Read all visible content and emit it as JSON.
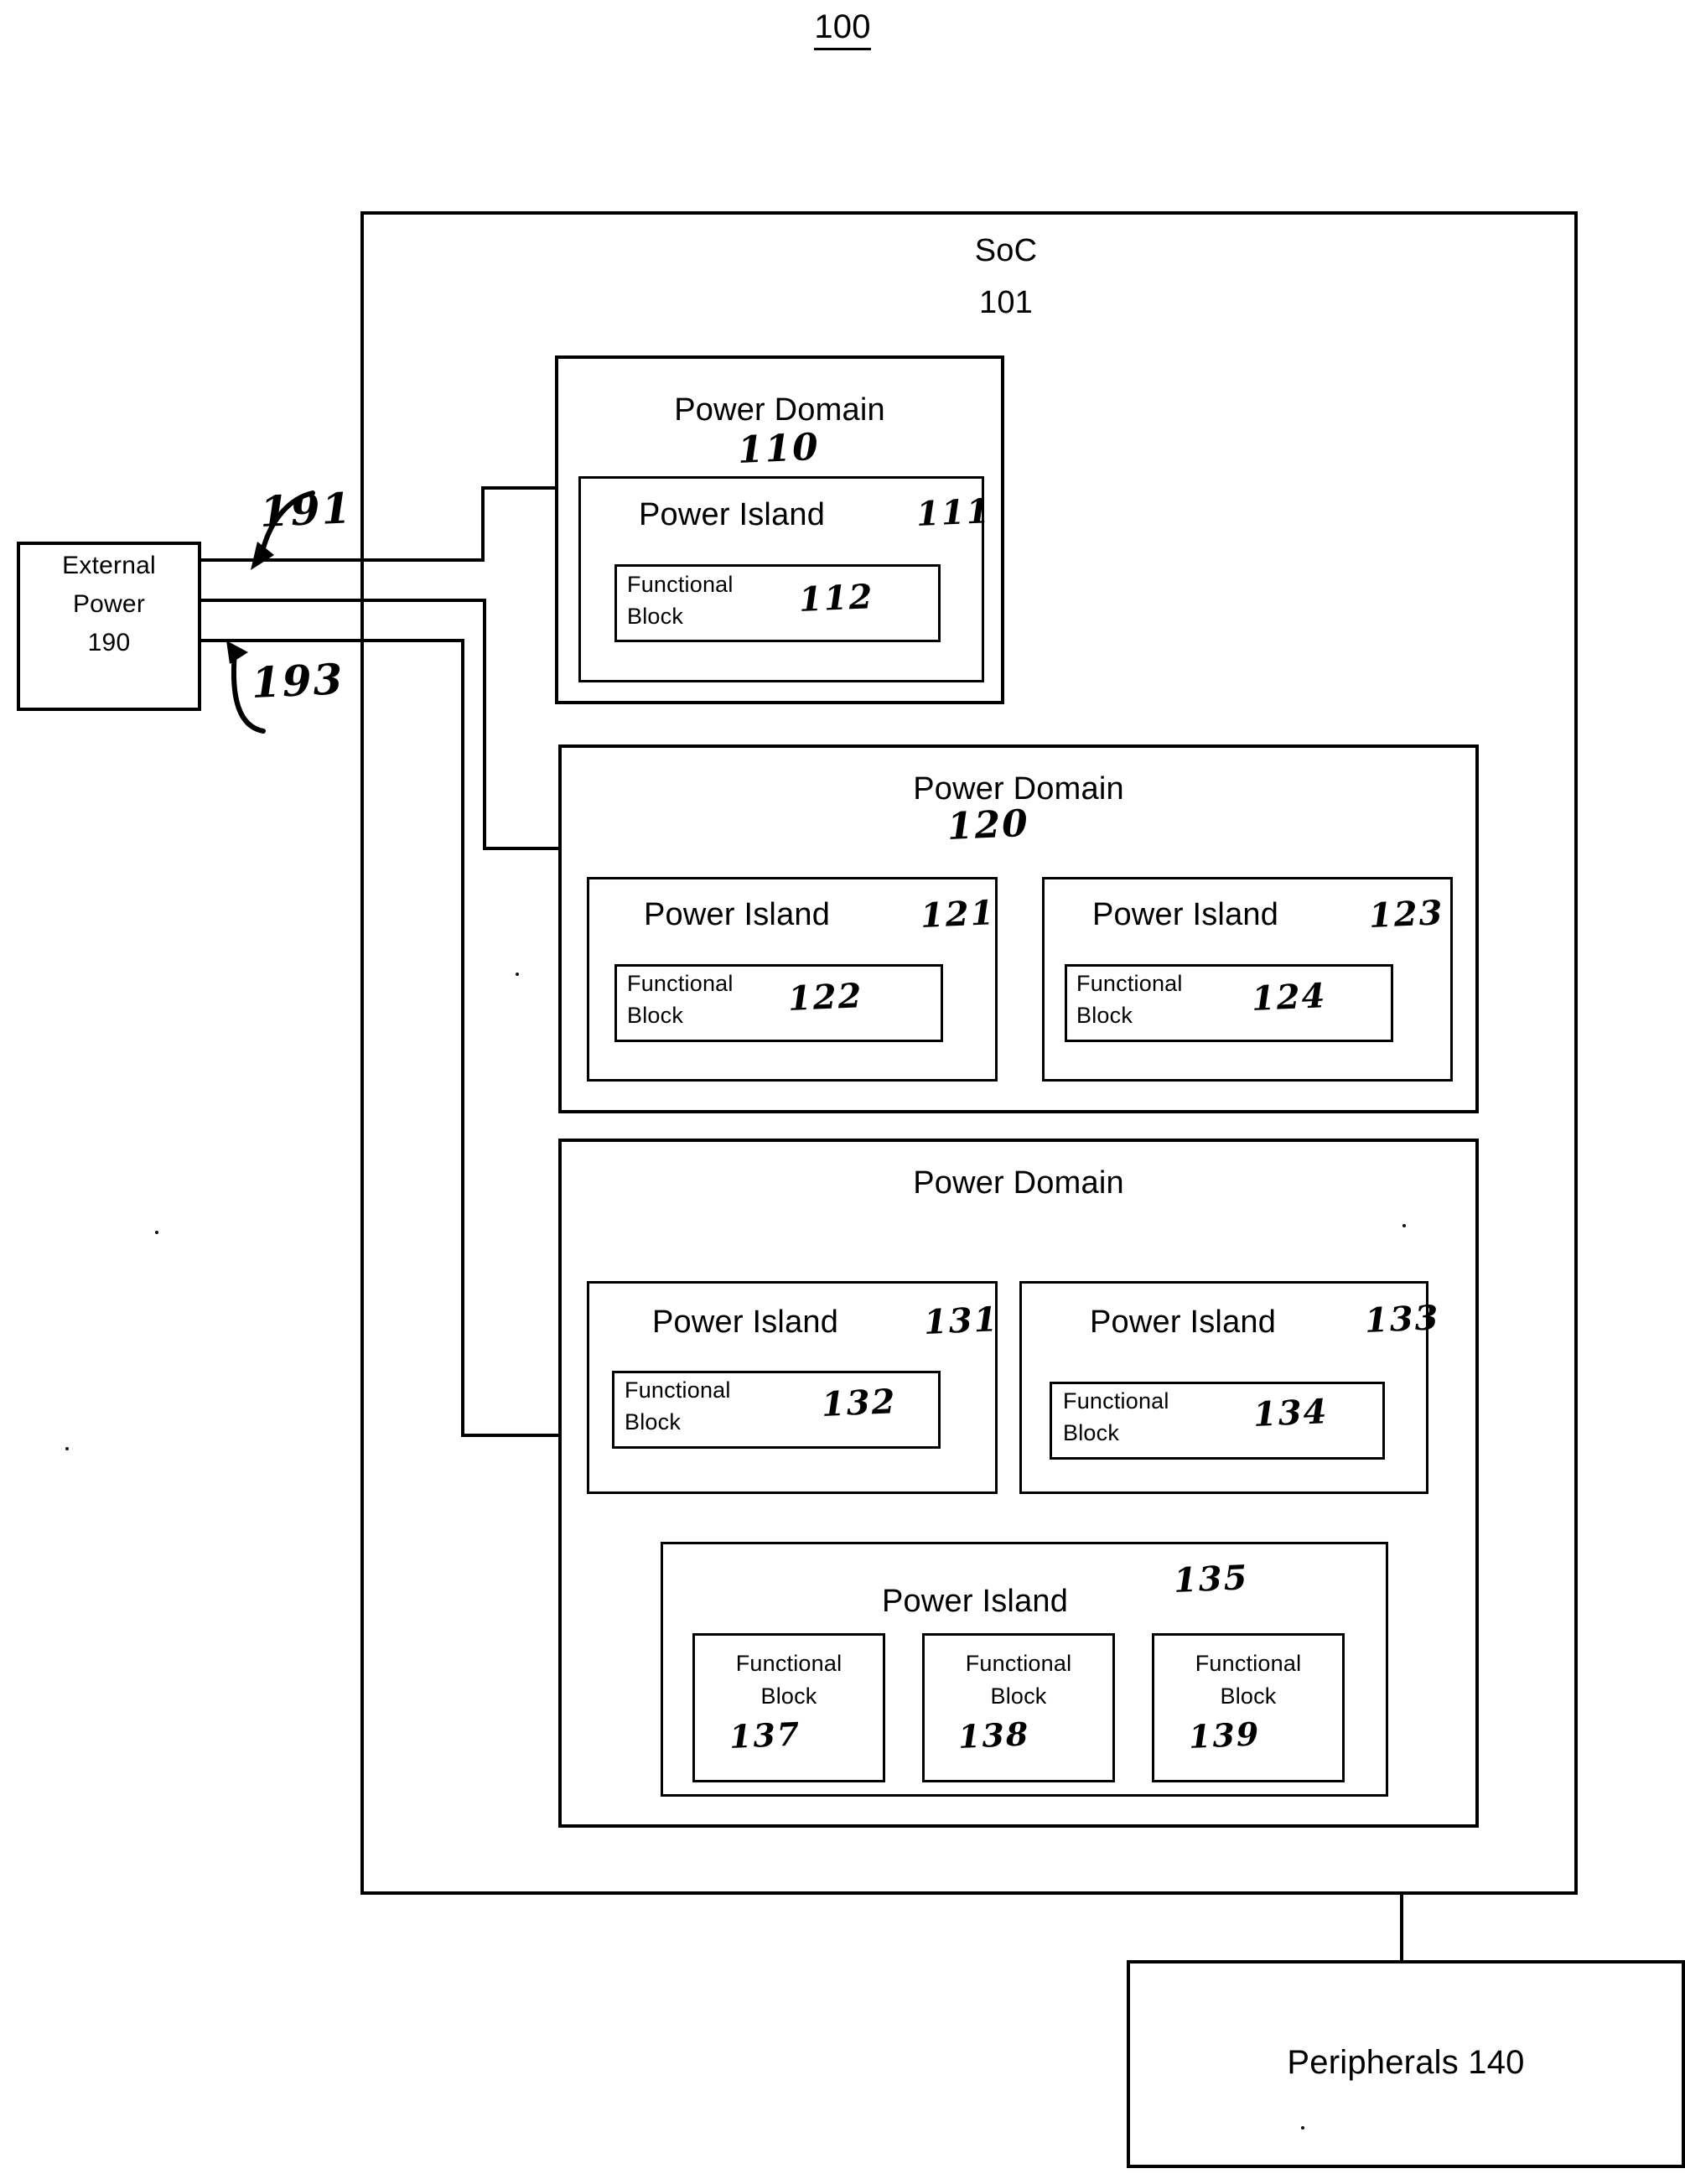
{
  "figure": {
    "number": "100"
  },
  "soc": {
    "title": "SoC",
    "ref": "101"
  },
  "external_power": {
    "line1": "External",
    "line2": "Power",
    "ref": "190"
  },
  "power_rails": [
    {
      "name": "rail-191",
      "callout": "191"
    },
    {
      "name": "rail-192",
      "callout": ""
    },
    {
      "name": "rail-193",
      "callout": "193"
    }
  ],
  "peripherals": {
    "label": "Peripherals 140"
  },
  "power_domains": [
    {
      "name": "power-domain-110",
      "label": "Power Domain",
      "ref": "110",
      "islands": [
        {
          "name": "power-island-111",
          "label": "Power Island",
          "ref": "111",
          "blocks": [
            {
              "name": "functional-block-112",
              "line1": "Functional",
              "line2": "Block",
              "ref": "112"
            }
          ]
        }
      ]
    },
    {
      "name": "power-domain-120",
      "label": "Power Domain",
      "ref": "120",
      "islands": [
        {
          "name": "power-island-121",
          "label": "Power Island",
          "ref": "121",
          "blocks": [
            {
              "name": "functional-block-122",
              "line1": "Functional",
              "line2": "Block",
              "ref": "122"
            }
          ]
        },
        {
          "name": "power-island-123",
          "label": "Power Island",
          "ref": "123",
          "blocks": [
            {
              "name": "functional-block-124",
              "line1": "Functional",
              "line2": "Block",
              "ref": "124"
            }
          ]
        }
      ]
    },
    {
      "name": "power-domain-130",
      "label": "Power Domain",
      "ref": "",
      "islands": [
        {
          "name": "power-island-131",
          "label": "Power Island",
          "ref": "131",
          "blocks": [
            {
              "name": "functional-block-132",
              "line1": "Functional",
              "line2": "Block",
              "ref": "132"
            }
          ]
        },
        {
          "name": "power-island-133",
          "label": "Power Island",
          "ref": "133",
          "blocks": [
            {
              "name": "functional-block-134",
              "line1": "Functional",
              "line2": "Block",
              "ref": "134"
            }
          ]
        },
        {
          "name": "power-island-135",
          "label": "Power Island",
          "ref": "135",
          "blocks": [
            {
              "name": "functional-block-137",
              "line1": "Functional",
              "line2": "Block",
              "ref": "137"
            },
            {
              "name": "functional-block-138",
              "line1": "Functional",
              "line2": "Block",
              "ref": "138"
            },
            {
              "name": "functional-block-139",
              "line1": "Functional",
              "line2": "Block",
              "ref": "139"
            }
          ]
        }
      ]
    }
  ],
  "colors": {
    "ink": "#000000",
    "paper": "#ffffff"
  }
}
